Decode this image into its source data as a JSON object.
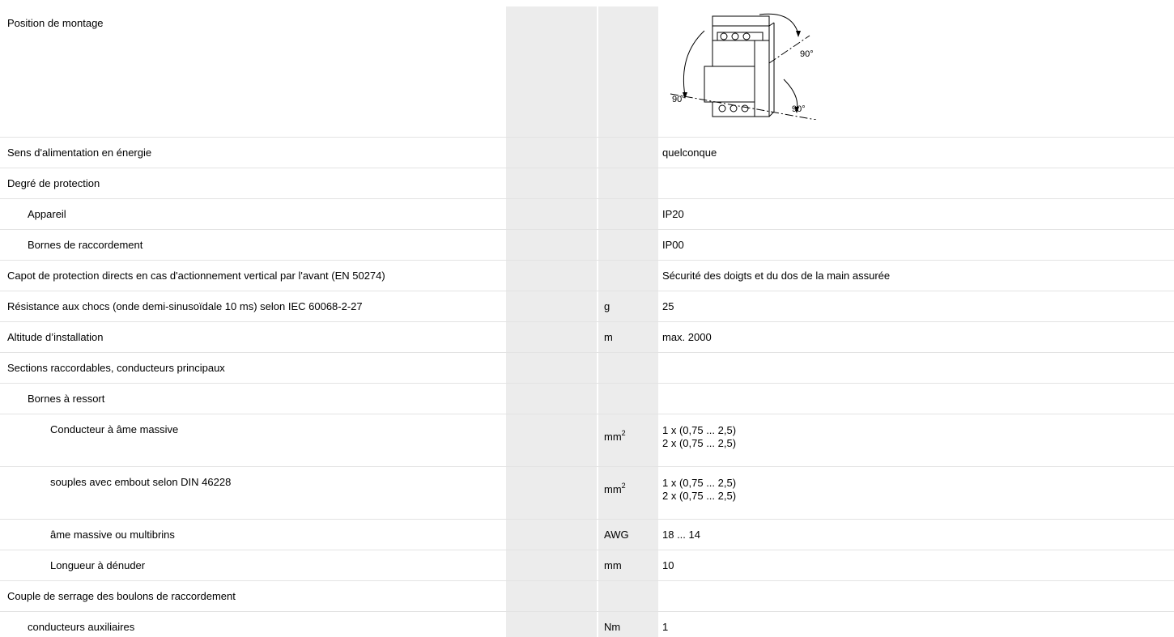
{
  "rows": [
    {
      "label": "Position de montage",
      "unit": "",
      "value": ""
    },
    {
      "label": "Sens d'alimentation en énergie",
      "unit": "",
      "value": "quelconque"
    },
    {
      "label": "Degré de protection",
      "unit": "",
      "value": ""
    },
    {
      "label": "Appareil",
      "unit": "",
      "value": "IP20"
    },
    {
      "label": "Bornes de raccordement",
      "unit": "",
      "value": "IP00"
    },
    {
      "label": "Capot de protection directs en cas d'actionnement vertical par l'avant (EN 50274)",
      "unit": "",
      "value": "Sécurité des doigts et du dos de la main assurée"
    },
    {
      "label": "Résistance aux chocs (onde demi-sinusoïdale 10 ms) selon IEC 60068-2-27",
      "unit": "g",
      "value": "25"
    },
    {
      "label": "Altitude d’installation",
      "unit": "m",
      "value": "max. 2000"
    },
    {
      "label": "Sections raccordables, conducteurs principaux",
      "unit": "",
      "value": ""
    },
    {
      "label": "Bornes à ressort",
      "unit": "",
      "value": ""
    },
    {
      "label": "Conducteur à âme massive",
      "unit_base": "mm",
      "unit_sup": "2",
      "value_line1": "1 x (0,75 ... 2,5)",
      "value_line2": "2 x (0,75 ... 2,5)"
    },
    {
      "label": "souples avec embout selon DIN 46228",
      "unit_base": "mm",
      "unit_sup": "2",
      "value_line1": "1 x (0,75 ... 2,5)",
      "value_line2": "2 x (0,75 ... 2,5)"
    },
    {
      "label": "âme massive ou multibrins",
      "unit": "AWG",
      "value": "18 ... 14"
    },
    {
      "label": "Longueur à dénuder",
      "unit": "mm",
      "value": "10"
    },
    {
      "label": "Couple de serrage des boulons de raccordement",
      "unit": "",
      "value": ""
    },
    {
      "label": "conducteurs auxiliaires",
      "unit": "Nm",
      "value": "1"
    }
  ],
  "diagram": {
    "angle_top_right": "90°",
    "angle_left": "90°",
    "angle_bottom_right": "90°"
  }
}
